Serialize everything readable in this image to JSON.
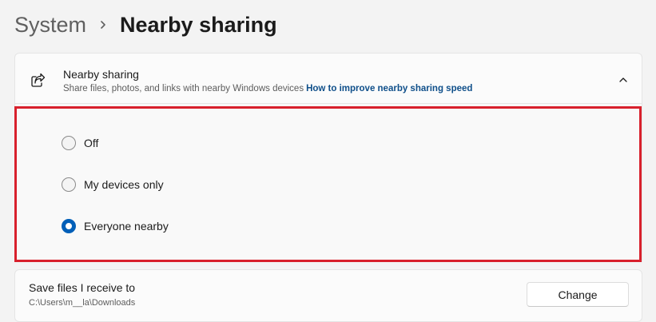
{
  "breadcrumb": {
    "parent": "System",
    "separator_icon": "chevron-right-icon",
    "current": "Nearby sharing"
  },
  "nearby_sharing": {
    "icon": "share-icon",
    "title": "Nearby sharing",
    "description": "Share files, photos, and links with nearby Windows devices",
    "link": "How to improve nearby sharing speed",
    "expand_icon": "chevron-up-icon",
    "options": [
      {
        "label": "Off",
        "selected": false
      },
      {
        "label": "My devices only",
        "selected": false
      },
      {
        "label": "Everyone nearby",
        "selected": true
      }
    ]
  },
  "save_files": {
    "title": "Save files I receive to",
    "path": "C:\\Users\\m__la\\Downloads",
    "button_label": "Change"
  },
  "colors": {
    "accent": "#005fb8",
    "link": "#0f4f8a",
    "highlight": "#d8202c",
    "background": "#f3f3f3"
  }
}
